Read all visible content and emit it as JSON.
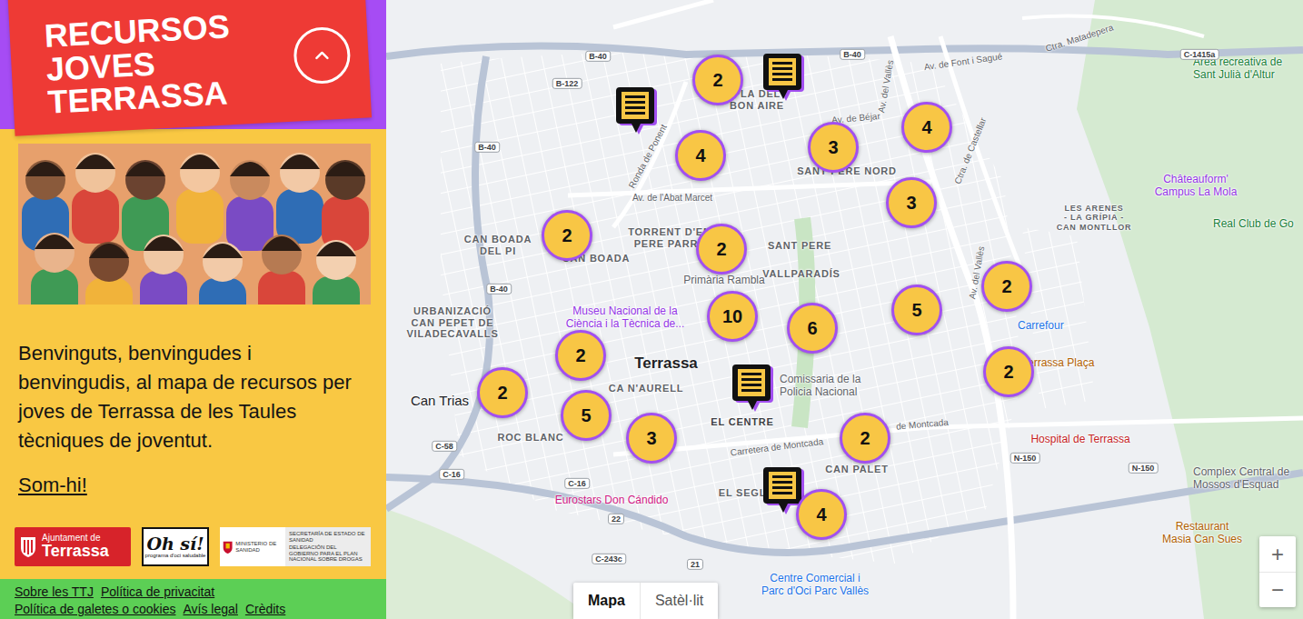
{
  "header": {
    "title_lines": [
      "RECURSOS",
      "JOVES",
      "TERRASSA"
    ],
    "toggle": {
      "expanded": true
    }
  },
  "intro": {
    "text": "Benvinguts, benvingudes i benvingudis, al mapa de recursos per joves de Terrassa de les Taules tècniques de joventut.",
    "link": "Som-hi!"
  },
  "sponsors": [
    {
      "kind": "ajuntament",
      "lines": [
        "Ajuntament de",
        "Terrassa"
      ]
    },
    {
      "kind": "ohsi",
      "lines": [
        "Oh sí!",
        "programa d'oci saludable"
      ]
    },
    {
      "kind": "ministerio",
      "lines": [
        "MINISTERIO DE SANIDAD",
        "SECRETARÍA DE ESTADO DE SANIDAD",
        "DELEGACIÓN DEL GOBIERNO PARA EL PLAN NACIONAL SOBRE DROGAS"
      ]
    }
  ],
  "footer": {
    "links": [
      "Sobre les TTJ",
      "Política de privacitat",
      "Política de galetes o cookies",
      "Avís legal",
      "Crèdits"
    ]
  },
  "map": {
    "types": [
      {
        "label": "Mapa",
        "selected": true
      },
      {
        "label": "Satèl·lit",
        "selected": false
      }
    ],
    "zoom": [
      "+",
      "−"
    ],
    "clusters": [
      {
        "count": "2"
      },
      {
        "count": "4"
      },
      {
        "count": "3"
      },
      {
        "count": "4"
      },
      {
        "count": "3"
      },
      {
        "count": "2"
      },
      {
        "count": "2"
      },
      {
        "count": "10"
      },
      {
        "count": "6"
      },
      {
        "count": "5"
      },
      {
        "count": "2"
      },
      {
        "count": "2"
      },
      {
        "count": "2"
      },
      {
        "count": "2"
      },
      {
        "count": "5"
      },
      {
        "count": "3"
      },
      {
        "count": "2"
      },
      {
        "count": "4"
      }
    ],
    "markers": [
      {
        "kind": "resource"
      },
      {
        "kind": "resource"
      },
      {
        "kind": "resource"
      },
      {
        "kind": "resource"
      }
    ],
    "labels": [
      {
        "text": "PLA DEL\nBON AIRE",
        "kind": "district",
        "color": "#5f6368"
      },
      {
        "text": "SANT PERE NORD",
        "kind": "district",
        "color": "#5f6368"
      },
      {
        "text": "TORRENT D'EN\nPERE PARRE",
        "kind": "district",
        "color": "#5f6368"
      },
      {
        "text": "SANT PERE",
        "kind": "district",
        "color": "#5f6368"
      },
      {
        "text": "VALLPARADÍS",
        "kind": "district",
        "color": "#5f6368"
      },
      {
        "text": "CAN BOADA\nDEL PI",
        "kind": "district",
        "color": "#5f6368"
      },
      {
        "text": "CAN BOADA",
        "kind": "district",
        "color": "#5f6368"
      },
      {
        "text": "URBANIZACIÓ\nCAN PEPET DE\nVILADECAVALLS",
        "kind": "district",
        "color": "#5f6368"
      },
      {
        "text": "Terrassa",
        "kind": "city",
        "color": "#202124"
      },
      {
        "text": "CA N'AURELL",
        "kind": "district",
        "color": "#5f6368"
      },
      {
        "text": "Can Trias",
        "kind": "town",
        "color": "#202124"
      },
      {
        "text": "ROC BLANC",
        "kind": "district",
        "color": "#5f6368"
      },
      {
        "text": "EL CENTRE",
        "kind": "district",
        "color": "#3c4043"
      },
      {
        "text": "CAN PALET",
        "kind": "district",
        "color": "#5f6368"
      },
      {
        "text": "EL SEGL",
        "kind": "district",
        "color": "#5f6368"
      },
      {
        "text": "LES ARENES\n- LA GRÍPIA -\nCAN MONTLLOR",
        "kind": "small",
        "color": "#5f6368"
      },
      {
        "text": "Carrefour",
        "kind": "poi",
        "color": "#1a73e8"
      },
      {
        "text": "Hospital de Terrassa",
        "kind": "poi",
        "color": "#c5221f"
      },
      {
        "text": "Eurostars Don Cándido",
        "kind": "poi",
        "color": "#d01884"
      },
      {
        "text": "Centre Comercial i\nParc d'Oci Parc Vallès",
        "kind": "poi",
        "color": "#1a73e8"
      },
      {
        "text": "Restaurant\nMasia Can Sues",
        "kind": "poi",
        "color": "#b06000"
      },
      {
        "text": "Complex Central de\nMossos d'Esquad",
        "kind": "poi",
        "color": "#5f6368"
      },
      {
        "text": "Châteauform'\nCampus La Mola",
        "kind": "poi",
        "color": "#9334e6"
      },
      {
        "text": "Real Club de Go",
        "kind": "poi",
        "color": "#188038"
      },
      {
        "text": "Àrea recreativa de\nSant Julià d'Altur",
        "kind": "poi",
        "color": "#188038"
      },
      {
        "text": "Museu Nacional de la\nCiència i la Tècnica de...",
        "kind": "poi",
        "color": "#9334e6"
      },
      {
        "text": "Comissaria de la\nPolicia Nacional",
        "kind": "poi",
        "color": "#5f6368"
      },
      {
        "text": "Primària Rambla",
        "kind": "poi",
        "color": "#5f6368"
      },
      {
        "text": "Terrassa Plaça",
        "kind": "poi",
        "color": "#b06000"
      },
      {
        "text": "Av. de l'Abat Marcet",
        "kind": "road",
        "color": "#5f6368"
      },
      {
        "text": "Ronda de Ponent",
        "kind": "road",
        "color": "#5f6368"
      },
      {
        "text": "Av. de Béjar",
        "kind": "road",
        "color": "#5f6368"
      },
      {
        "text": "Av. de Font i Sagué",
        "kind": "road",
        "color": "#5f6368"
      },
      {
        "text": "Av. del Vallès",
        "kind": "road",
        "color": "#5f6368"
      },
      {
        "text": "Av. del Vallès",
        "kind": "road",
        "color": "#5f6368"
      },
      {
        "text": "Ctra. de Castellar",
        "kind": "road",
        "color": "#5f6368"
      },
      {
        "text": "Carretera de Montcada",
        "kind": "road",
        "color": "#5f6368"
      },
      {
        "text": "de Montcada",
        "kind": "road",
        "color": "#5f6368"
      },
      {
        "text": "Ctra. Matadepera",
        "kind": "road",
        "color": "#5f6368"
      },
      {
        "text": "B-40",
        "kind": "shield",
        "color": "#3c4043"
      },
      {
        "text": "B-40",
        "kind": "shield",
        "color": "#3c4043"
      },
      {
        "text": "B-40",
        "kind": "shield",
        "color": "#3c4043"
      },
      {
        "text": "B-40",
        "kind": "shield",
        "color": "#3c4043"
      },
      {
        "text": "B-122",
        "kind": "shield",
        "color": "#3c4043"
      },
      {
        "text": "C-58",
        "kind": "shield",
        "color": "#3c4043"
      },
      {
        "text": "C-16",
        "kind": "shield",
        "color": "#3c4043"
      },
      {
        "text": "C-16",
        "kind": "shield",
        "color": "#3c4043"
      },
      {
        "text": "N-150",
        "kind": "shield",
        "color": "#3c4043"
      },
      {
        "text": "N-150",
        "kind": "shield",
        "color": "#3c4043"
      },
      {
        "text": "C-243c",
        "kind": "shield",
        "color": "#3c4043"
      },
      {
        "text": "22",
        "kind": "shield",
        "color": "#3c4043"
      },
      {
        "text": "21",
        "kind": "shield",
        "color": "#3c4043"
      },
      {
        "text": "C-1415a",
        "kind": "shield",
        "color": "#3c4043"
      }
    ]
  }
}
